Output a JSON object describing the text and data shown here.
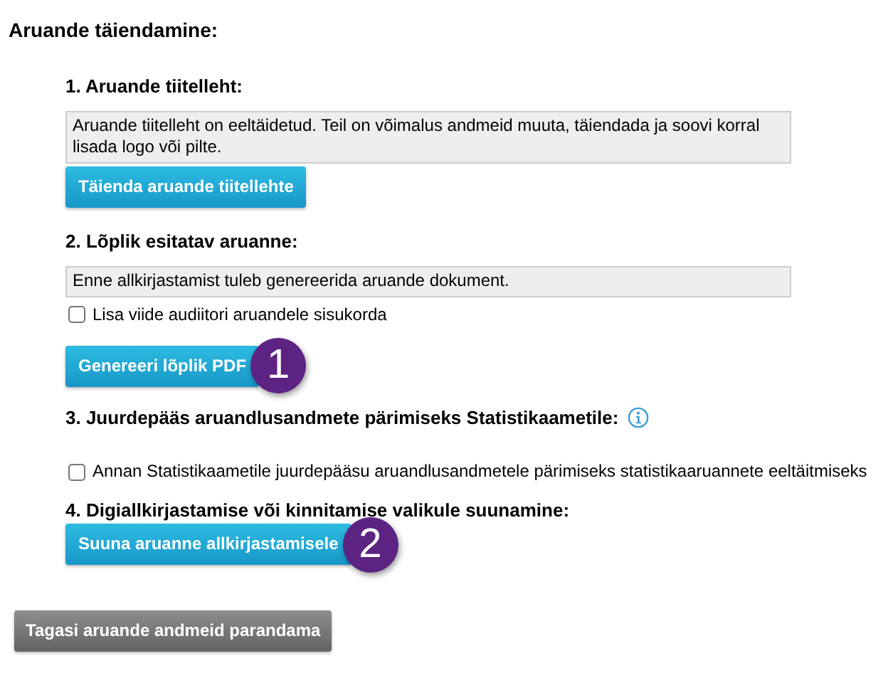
{
  "title": "Aruande täiendamine:",
  "sections": [
    {
      "heading": "1. Aruande tiitelleht:",
      "info_icon": false,
      "items": [
        {
          "kind": "note",
          "text": "Aruande tiitelleht on eeltäidetud. Teil on võimalus andmeid muuta, täiendada ja soovi korral lisada logo või pilte."
        },
        {
          "kind": "button",
          "label": "Täienda aruande tiitellehte"
        }
      ]
    },
    {
      "heading": "2. Lõplik esitatav aruanne:",
      "info_icon": false,
      "items": [
        {
          "kind": "note",
          "text": "Enne allkirjastamist tuleb genereerida aruande dokument."
        },
        {
          "kind": "checkbox",
          "label": "Lisa viide audiitori aruandele sisukorda",
          "checked": false
        },
        {
          "kind": "button",
          "label": "Genereeri lõplik PDF",
          "step": "1"
        }
      ]
    },
    {
      "heading": "3. Juurdepääs aruandlusandmete pärimiseks Statistikaametile:",
      "info_icon": true,
      "items": [
        {
          "kind": "checkbox",
          "label": "Annan Statistikaametile juurdepääsu aruandlusandmetele pärimiseks statistikaaruannete eeltäitmiseks",
          "checked": false
        }
      ]
    },
    {
      "heading": "4. Digiallkirjastamise või kinnitamise valikule suunamine:",
      "info_icon": false,
      "items": [
        {
          "kind": "button",
          "label": "Suuna aruanne allkirjastamisele",
          "step": "2"
        }
      ]
    }
  ],
  "back_button": "Tagasi aruande andmeid parandama"
}
